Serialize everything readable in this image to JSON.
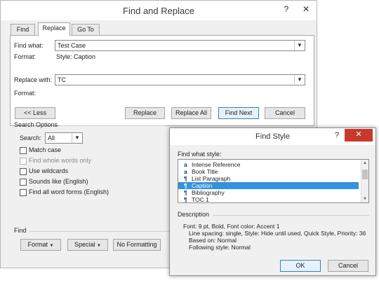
{
  "find_replace": {
    "title": "Find and Replace",
    "help_icon": "?",
    "minimize_icon": "—",
    "close_icon": "✕",
    "tabs": [
      {
        "label": "Find",
        "active": false
      },
      {
        "label": "Replace",
        "active": true
      },
      {
        "label": "Go To",
        "active": false
      }
    ],
    "find_what_label": "Find what:",
    "find_what_value": "Test Case",
    "find_format_label": "Format:",
    "find_format_value": "Style: Caption",
    "replace_with_label": "Replace with:",
    "replace_with_value": "TC",
    "replace_format_label": "Format:",
    "buttons": {
      "less": "<< Less",
      "replace": "Replace",
      "replace_all": "Replace All",
      "find_next": "Find Next",
      "cancel": "Cancel"
    },
    "search_options": {
      "title": "Search Options",
      "search_label": "Search:",
      "search_value": "All",
      "checkboxes": [
        {
          "label": "Match case",
          "checked": false,
          "enabled": true
        },
        {
          "label": "Find whole words only",
          "checked": false,
          "enabled": false
        },
        {
          "label": "Use wildcards",
          "checked": false,
          "enabled": true
        },
        {
          "label": "Sounds like (English)",
          "checked": false,
          "enabled": true
        },
        {
          "label": "Find all word forms (English)",
          "checked": false,
          "enabled": true
        }
      ]
    },
    "find_group": {
      "title": "Find",
      "format_button": "Format",
      "special_button": "Special",
      "no_formatting_button": "No Formatting"
    }
  },
  "find_style": {
    "title": "Find Style",
    "help_icon": "?",
    "close_icon": "✕",
    "list_label": "Find what style:",
    "styles": [
      {
        "glyph": "a",
        "name": "Intense Reference",
        "selected": false
      },
      {
        "glyph": "a",
        "name": "Book Title",
        "selected": false
      },
      {
        "glyph": "¶",
        "name": "List Paragraph",
        "selected": false
      },
      {
        "glyph": "¶",
        "name": "Caption",
        "selected": true
      },
      {
        "glyph": "¶",
        "name": "Bibliography",
        "selected": false
      },
      {
        "glyph": "¶",
        "name": "TOC 1",
        "selected": false
      }
    ],
    "description_title": "Description",
    "description_lines": [
      "Font: 9 pt, Bold, Font color: Accent 1",
      "Line spacing:  single, Style: Hide until used, Quick Style, Priority: 36",
      "Based on: Normal",
      "Following style: Normal"
    ],
    "ok": "OK",
    "cancel": "Cancel"
  },
  "colors": {
    "selection": "#3393df",
    "close_button": "#c7392b",
    "dialog_bg": "#f0f0f0"
  }
}
